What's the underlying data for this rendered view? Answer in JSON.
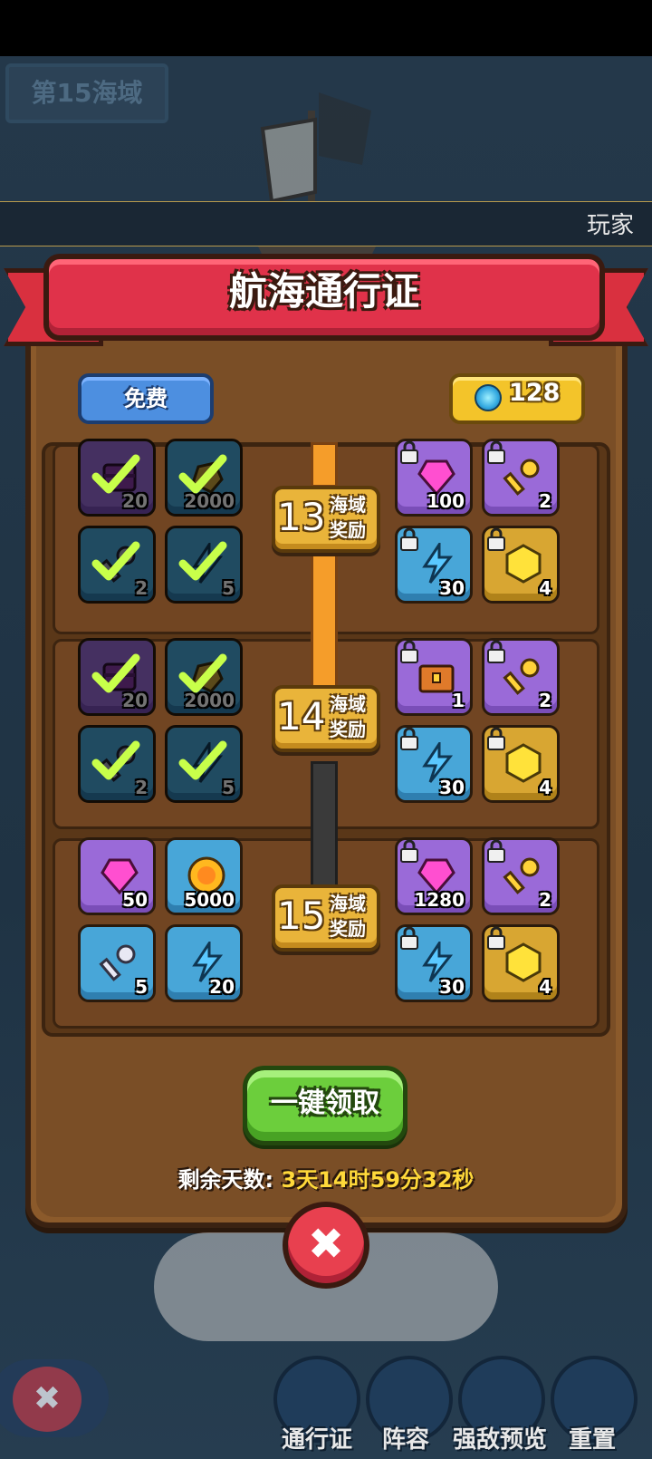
{
  "header": {
    "sea_region": "第15海域",
    "player_label": "玩家"
  },
  "pass": {
    "title": "航海通行证",
    "free_tab": "免费",
    "paid_value": "128",
    "tiers": [
      {
        "level": "13",
        "label_a": "海域",
        "label_b": "奖励",
        "progress": "filled",
        "free": [
          {
            "icon": "purple-chest-icon",
            "qty": "20",
            "claimed": true
          },
          {
            "icon": "gold-ore-icon",
            "qty": "2000",
            "claimed": true
          },
          {
            "icon": "key-icon",
            "qty": "2",
            "claimed": true
          },
          {
            "icon": "energy-icon",
            "qty": "5",
            "claimed": true
          }
        ],
        "paid": [
          {
            "icon": "pink-gem-icon",
            "qty": "100",
            "locked": true
          },
          {
            "icon": "gold-key-icon",
            "qty": "2",
            "locked": true
          },
          {
            "icon": "energy-icon",
            "qty": "30",
            "locked": true
          },
          {
            "icon": "gold-hexagon-icon",
            "qty": "4",
            "locked": true
          }
        ]
      },
      {
        "level": "14",
        "label_a": "海域",
        "label_b": "奖励",
        "progress": "partial",
        "free": [
          {
            "icon": "purple-chest-icon",
            "qty": "20",
            "claimed": true
          },
          {
            "icon": "gold-ore-icon",
            "qty": "2000",
            "claimed": true
          },
          {
            "icon": "key-icon",
            "qty": "2",
            "claimed": true
          },
          {
            "icon": "energy-icon",
            "qty": "5",
            "claimed": true
          }
        ],
        "paid": [
          {
            "icon": "treasure-chest-icon",
            "qty": "1",
            "locked": true
          },
          {
            "icon": "gold-key-icon",
            "qty": "2",
            "locked": true
          },
          {
            "icon": "energy-icon",
            "qty": "30",
            "locked": true
          },
          {
            "icon": "gold-hexagon-icon",
            "qty": "4",
            "locked": true
          }
        ]
      },
      {
        "level": "15",
        "label_a": "海域",
        "label_b": "奖励",
        "progress": "empty",
        "free": [
          {
            "icon": "pink-gem-icon",
            "qty": "50",
            "claimed": false
          },
          {
            "icon": "gold-coin-icon",
            "qty": "5000",
            "claimed": false
          },
          {
            "icon": "silver-key-icon",
            "qty": "5",
            "claimed": false
          },
          {
            "icon": "energy-icon",
            "qty": "20",
            "claimed": false
          }
        ],
        "paid": [
          {
            "icon": "pink-gem-icon",
            "qty": "1280",
            "locked": true
          },
          {
            "icon": "gold-key-icon",
            "qty": "2",
            "locked": true
          },
          {
            "icon": "energy-icon",
            "qty": "30",
            "locked": true
          },
          {
            "icon": "gold-hexagon-icon",
            "qty": "4",
            "locked": true
          }
        ]
      }
    ],
    "claim_all_label": "一键领取",
    "remaining_label": "剩余天数:",
    "remaining_value": "3天14时59分32秒"
  },
  "nav": {
    "items": [
      "通行证",
      "阵容",
      "强敌预览",
      "重置"
    ]
  },
  "colors": {
    "ribbon": "#e0324a",
    "panel": "#8b5a2b",
    "progress": "#f59d2a",
    "claim": "#6cce3c"
  }
}
